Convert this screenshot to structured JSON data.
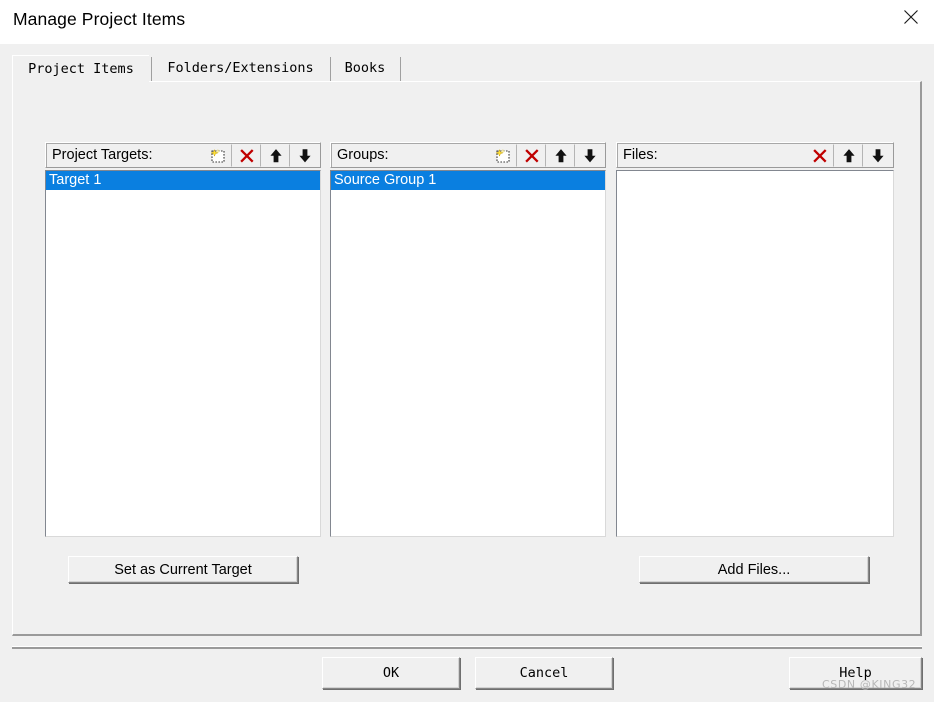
{
  "window": {
    "title": "Manage Project Items",
    "close_icon": "close-icon"
  },
  "tabs": [
    {
      "label": "Project Items",
      "active": true
    },
    {
      "label": "Folders/Extensions",
      "active": false
    },
    {
      "label": "Books",
      "active": false
    }
  ],
  "columns": [
    {
      "id": "project-targets",
      "label": "Project Targets:",
      "tools": [
        "new-item-icon",
        "delete-icon",
        "move-up-icon",
        "move-down-icon"
      ],
      "items": [
        {
          "label": "Target 1",
          "selected": true
        }
      ]
    },
    {
      "id": "groups",
      "label": "Groups:",
      "tools": [
        "new-item-icon",
        "delete-icon",
        "move-up-icon",
        "move-down-icon"
      ],
      "items": [
        {
          "label": "Source Group 1",
          "selected": true
        }
      ]
    },
    {
      "id": "files",
      "label": "Files:",
      "tools": [
        "delete-icon",
        "move-up-icon",
        "move-down-icon"
      ],
      "items": []
    }
  ],
  "actions": {
    "set_current_target": "Set as Current Target",
    "add_files": "Add Files..."
  },
  "dialog_buttons": {
    "ok": "OK",
    "cancel": "Cancel",
    "help": "Help"
  },
  "watermark": "CSDN @KING32",
  "colors": {
    "selection": "#0a7fe0",
    "delete_icon": "#c00000",
    "face": "#f0f0f0",
    "sunken_border": "#828790"
  }
}
